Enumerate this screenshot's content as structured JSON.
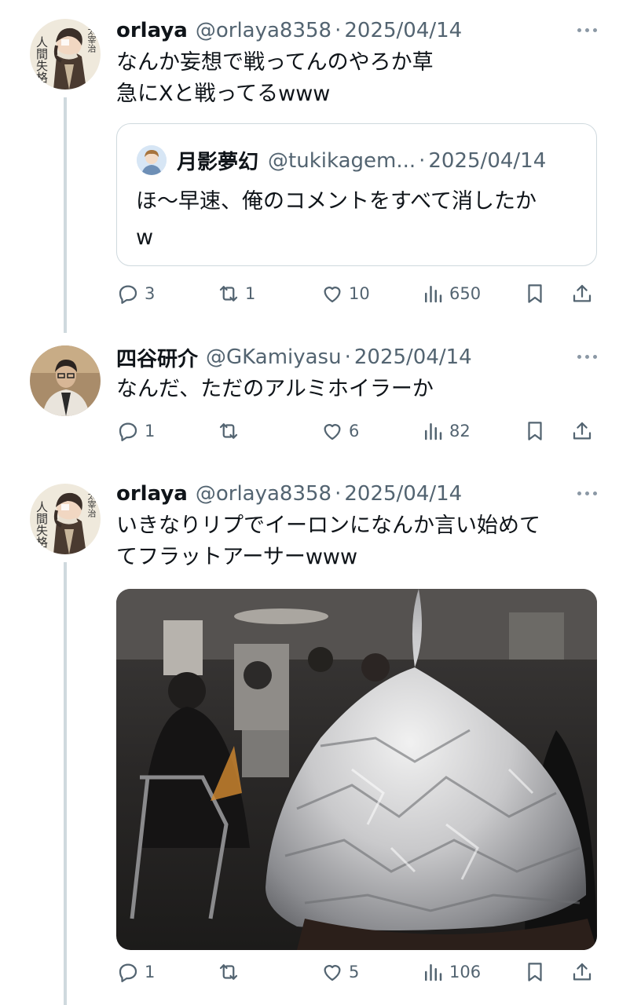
{
  "tweets": [
    {
      "name": "orlaya",
      "handle": "@orlaya8358",
      "date": "2025/04/14",
      "lines": [
        "なんか妄想で戦ってんのやろか草",
        "急にXと戦ってるwww"
      ],
      "quote": {
        "name": "月影夢幻",
        "handle": "@tukikagem...",
        "date": "2025/04/14",
        "lines": [
          "ほ〜早速、俺のコメントをすべて消したか",
          "w"
        ]
      },
      "stats": {
        "replies": "3",
        "reposts": "1",
        "likes": "10",
        "views": "650"
      }
    },
    {
      "name": "四谷研介",
      "handle": "@GKamiyasu",
      "date": "2025/04/14",
      "lines": [
        "なんだ、ただのアルミホイラーか"
      ],
      "stats": {
        "replies": "1",
        "reposts": "",
        "likes": "6",
        "views": "82"
      }
    },
    {
      "name": "orlaya",
      "handle": "@orlaya8358",
      "date": "2025/04/14",
      "lines": [
        "いきなりリプでイーロンになんか言い始めて",
        "てフラットアーサーwww"
      ],
      "stats": {
        "replies": "1",
        "reposts": "",
        "likes": "5",
        "views": "106"
      }
    }
  ],
  "avatar_text": [
    "人間失格",
    "太宰治"
  ],
  "colors": {
    "text": "#0f1419",
    "muted": "#536471",
    "border": "#cfd9de",
    "thread": "#cfd9de"
  },
  "icons": [
    "reply-icon",
    "repost-icon",
    "like-icon",
    "views-icon",
    "bookmark-icon",
    "share-icon",
    "more-icon"
  ]
}
